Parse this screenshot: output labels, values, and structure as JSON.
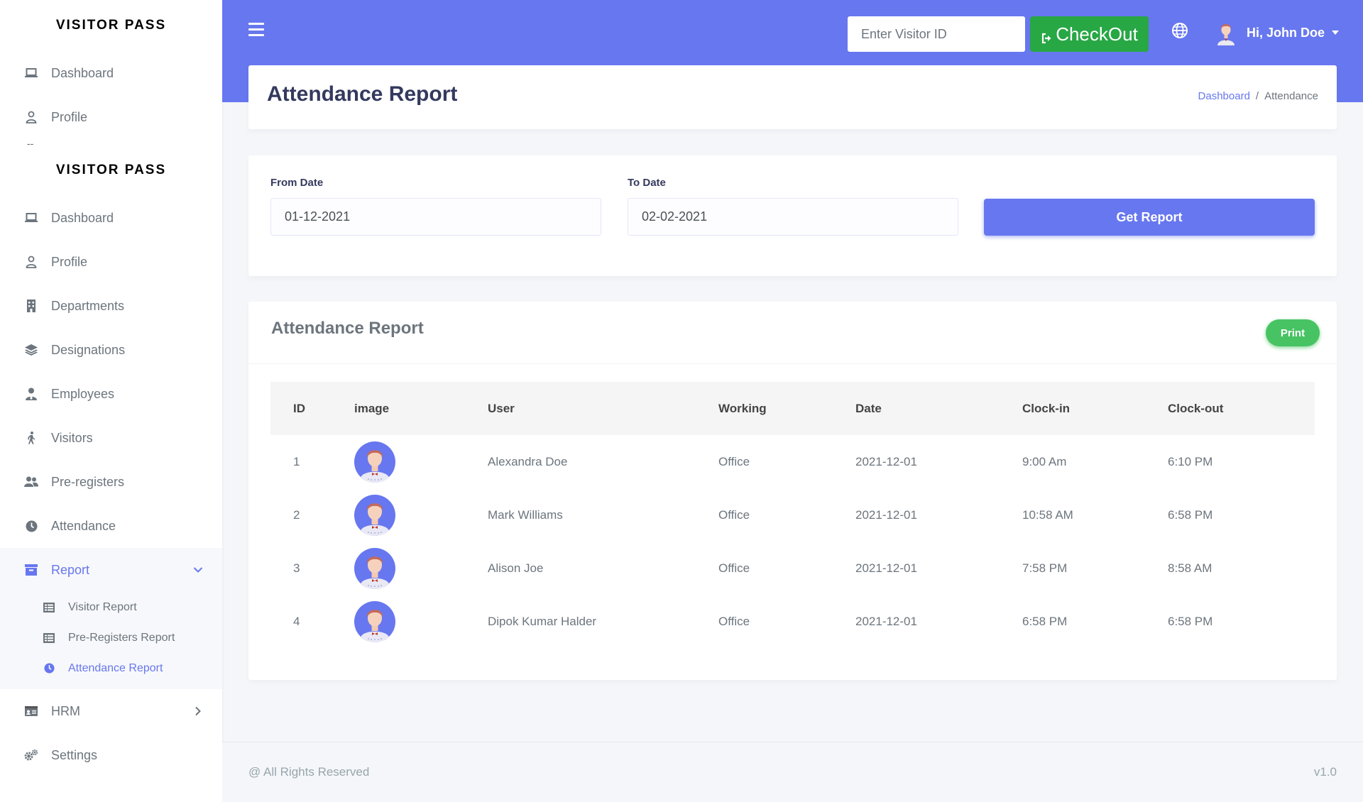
{
  "sidebar": {
    "brand_top": "VISITOR PASS",
    "brand_main": "VISITOR PASS",
    "dash": "--",
    "top_items": [
      {
        "label": "Dashboard",
        "icon": "laptop-icon"
      },
      {
        "label": "Profile",
        "icon": "user-icon"
      }
    ],
    "items": [
      {
        "label": "Dashboard",
        "icon": "laptop-icon"
      },
      {
        "label": "Profile",
        "icon": "user-icon"
      },
      {
        "label": "Departments",
        "icon": "building-icon"
      },
      {
        "label": "Designations",
        "icon": "layer-group-icon"
      },
      {
        "label": "Employees",
        "icon": "user-tie-icon"
      },
      {
        "label": "Visitors",
        "icon": "walking-icon"
      },
      {
        "label": "Pre-registers",
        "icon": "users-icon"
      },
      {
        "label": "Attendance",
        "icon": "clock-icon"
      },
      {
        "label": "Report",
        "icon": "archive-icon"
      }
    ],
    "report_sub": [
      {
        "label": "Visitor Report",
        "icon": "list-icon"
      },
      {
        "label": "Pre-Registers Report",
        "icon": "list-icon"
      },
      {
        "label": "Attendance Report",
        "icon": "clock-icon"
      }
    ],
    "bottom_items": [
      {
        "label": "HRM",
        "icon": "id-card-icon"
      },
      {
        "label": "Settings",
        "icon": "cogs-icon"
      }
    ]
  },
  "header": {
    "visitor_placeholder": "Enter Visitor ID",
    "checkout_label": "CheckOut",
    "user_greeting": "Hi, John Doe"
  },
  "page": {
    "title": "Attendance Report",
    "breadcrumb": {
      "home": "Dashboard",
      "sep": "/",
      "current": "Attendance"
    }
  },
  "filter": {
    "from_label": "From Date",
    "from_value": "01-12-2021",
    "to_label": "To Date",
    "to_value": "02-02-2021",
    "button_label": "Get Report"
  },
  "report": {
    "title": "Attendance Report",
    "print_label": "Print",
    "columns": {
      "id": "ID",
      "image": "image",
      "user": "User",
      "working": "Working",
      "date": "Date",
      "clock_in": "Clock-in",
      "clock_out": "Clock-out"
    },
    "rows": [
      {
        "id": "1",
        "user": "Alexandra Doe",
        "working": "Office",
        "date": "2021-12-01",
        "clock_in": "9:00 Am",
        "clock_out": "6:10 PM"
      },
      {
        "id": "2",
        "user": "Mark Williams",
        "working": "Office",
        "date": "2021-12-01",
        "clock_in": "10:58 AM",
        "clock_out": "6:58 PM"
      },
      {
        "id": "3",
        "user": "Alison Joe",
        "working": "Office",
        "date": "2021-12-01",
        "clock_in": "7:58 PM",
        "clock_out": "8:58 AM"
      },
      {
        "id": "4",
        "user": "Dipok Kumar Halder",
        "working": "Office",
        "date": "2021-12-01",
        "clock_in": "6:58 PM",
        "clock_out": "6:58 PM"
      }
    ]
  },
  "footer": {
    "copyright": "@ All Rights Reserved",
    "version": "v1.0"
  },
  "colors": {
    "primary": "#6777ef",
    "success": "#28a745",
    "print": "#47c363",
    "text": "#6c757d"
  }
}
